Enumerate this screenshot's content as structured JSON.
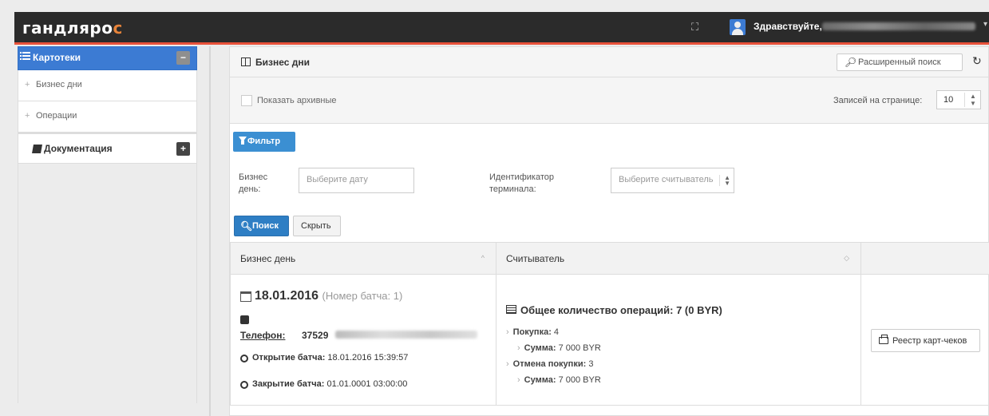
{
  "header": {
    "logo_parts": [
      "гандляро",
      "с",
      ""
    ],
    "greeting": "Здравствуйте, ",
    "caret": "▾",
    "fullscreen_icon": "fullscreen-icon"
  },
  "sidebar": {
    "section_cards": {
      "label": "Картотеки",
      "toggle": "−"
    },
    "items": [
      {
        "label": "Бизнес дни",
        "bullet": "+"
      },
      {
        "label": "Операции",
        "bullet": "+"
      }
    ],
    "section_docs": {
      "label": "Документация",
      "toggle": "+"
    }
  },
  "panel": {
    "title": "Бизнес дни",
    "advanced_search": "Расширенный поиск",
    "refresh_icon": "↻"
  },
  "options": {
    "show_archived": "Показать архивные",
    "per_page_label": "Записей на странице:",
    "per_page_value": "10",
    "per_page_arrows": "▲\n▼"
  },
  "filter": {
    "button": "Фильтр",
    "business_day_label": "Бизнес день:",
    "business_day_placeholder": "Выберите дату",
    "terminal_label": "Идентификатор терминала:",
    "terminal_placeholder": "Выберите считыватель",
    "search_button": "Поиск",
    "hide_button": "Скрыть"
  },
  "table": {
    "columns": [
      "Бизнес день",
      "Считыватель",
      ""
    ],
    "sort_icons": [
      "^",
      "◇"
    ],
    "rows": [
      {
        "date": "18.01.2016",
        "batch": "(Номер батча: 1)",
        "phone_label": "Телефон:",
        "phone_value": "37529",
        "open_label": "Открытие батча:",
        "open_value": "18.01.2016 15:39:57",
        "close_label": "Закрытие батча:",
        "close_value": "01.01.0001 03:00:00",
        "ops_total": "Общее количество операций: 7 (0 BYR)",
        "purchase_label": "Покупка:",
        "purchase_value": "4",
        "purchase_sum_label": "Сумма:",
        "purchase_sum_value": "7 000 BYR",
        "cancel_label": "Отмена покупки:",
        "cancel_value": "3",
        "cancel_sum_label": "Сумма:",
        "cancel_sum_value": "7 000 BYR",
        "action": "Реестр карт-чеков"
      }
    ]
  },
  "colors": {
    "topbar": "#2b2b2b",
    "topbar_accent": "#e8513a",
    "primary": "#3c7bd3",
    "filter_button": "#3b8fd2"
  }
}
